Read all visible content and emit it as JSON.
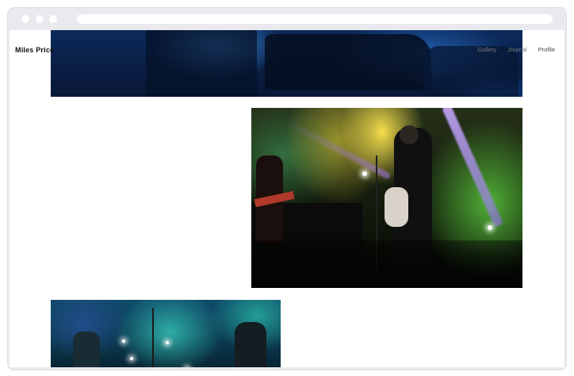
{
  "site": {
    "brand": "Miles Price",
    "nav": [
      "Gallery",
      "Journal",
      "Profile"
    ]
  },
  "photos": [
    {
      "name": "concert-photo-blue",
      "dominant_color": "#0b2a5b"
    },
    {
      "name": "concert-photo-singer-beams",
      "dominant_color": "#253018"
    },
    {
      "name": "concert-photo-teal",
      "dominant_color": "#0f4a6a"
    }
  ],
  "window": {
    "traffic_lights": [
      "close-dot",
      "minimize-dot",
      "zoom-dot"
    ],
    "chrome_color": "#e9e9ee"
  }
}
